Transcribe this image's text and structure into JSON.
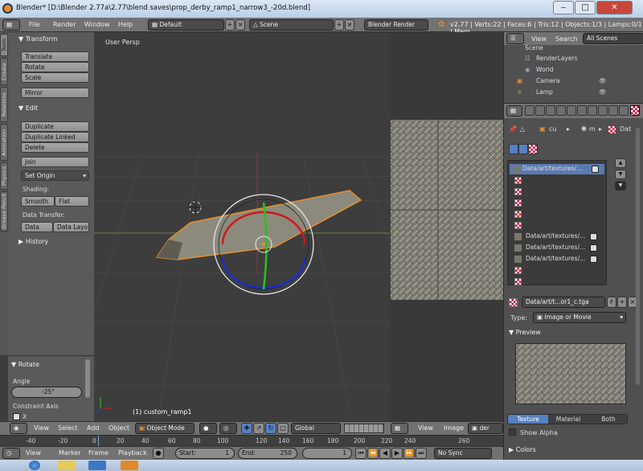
{
  "titlebar": {
    "title": "Blender* [D:\\Blender 2.77a\\2.77\\blend saves\\prop_derby_ramp1_narrow3_-20d.blend]",
    "min": "‒",
    "max": "□",
    "close": "✕"
  },
  "menubar": {
    "menus": [
      "File",
      "Render",
      "Window",
      "Help"
    ],
    "layout": "Default",
    "scene": "Scene",
    "engine": "Blender Render",
    "stats": "v2.77 | Verts:22 | Faces:6 | Tris:12 | Objects:1/3 | Lamps:0/1 | Mem"
  },
  "tabs": [
    "Tools",
    "Create",
    "Relations",
    "Animation",
    "Physics",
    "Grease Pencil"
  ],
  "toolshelf": {
    "transform_header": "Transform",
    "translate": "Translate",
    "rotate": "Rotate",
    "scale": "Scale",
    "mirror": "Mirror",
    "edit_header": "Edit",
    "duplicate": "Duplicate",
    "duplicate_linked": "Duplicate Linked",
    "delete": "Delete",
    "join": "Join",
    "set_origin": "Set Origin",
    "shading_label": "Shading:",
    "smooth": "Smooth",
    "flat": "Flat",
    "data_transfer_label": "Data Transfer:",
    "data": "Data",
    "data_layout": "Data Layo",
    "history_header": "History"
  },
  "operator": {
    "header": "Rotate",
    "angle_label": "Angle",
    "angle_value": "-25°",
    "constraint_label": "Constraint Axis",
    "x_label": "X"
  },
  "viewport": {
    "view_label": "User Persp",
    "object_label": "(1) custom_ramp1"
  },
  "view3d_header": {
    "menus": [
      "View",
      "Select",
      "Add",
      "Object"
    ],
    "mode": "Object Mode",
    "orientation": "Global"
  },
  "image_header": {
    "menus": [
      "View",
      "Image"
    ],
    "image_field": "der"
  },
  "timeline": {
    "ticks": [
      "-40",
      "-20",
      "0",
      "20",
      "40",
      "60",
      "80",
      "100",
      "120",
      "140",
      "160",
      "180",
      "200",
      "220",
      "240",
      "260"
    ],
    "menus": [
      "View",
      "Marker",
      "Frame",
      "Playback"
    ],
    "start": "Start:",
    "start_value": "1",
    "end": "End:",
    "end_value": "250",
    "current": "1",
    "sync": "No Sync"
  },
  "outliner": {
    "tabs": [
      "View",
      "Search",
      "All Scenes"
    ],
    "items": [
      "Scene",
      "RenderLayers",
      "World",
      "Camera",
      "Lamp"
    ]
  },
  "properties": {
    "breadcrumb": [
      "cu",
      "m",
      "Dat"
    ],
    "slots": [
      "Data/art/textures/...",
      "",
      "",
      "",
      "",
      "",
      "Data/art/textures/...",
      "Data/art/textures/...",
      "Data/art/textures/...",
      "",
      ""
    ],
    "texture_name": "Data/art/t...or1_c.tga",
    "f_label": "F",
    "type_label": "Type:",
    "type_value": "Image or Movie",
    "preview_header": "Preview",
    "preview_tabs": [
      "Texture",
      "Material",
      "Both"
    ],
    "show_alpha": "Show Alpha",
    "colors_header": "Colors"
  }
}
